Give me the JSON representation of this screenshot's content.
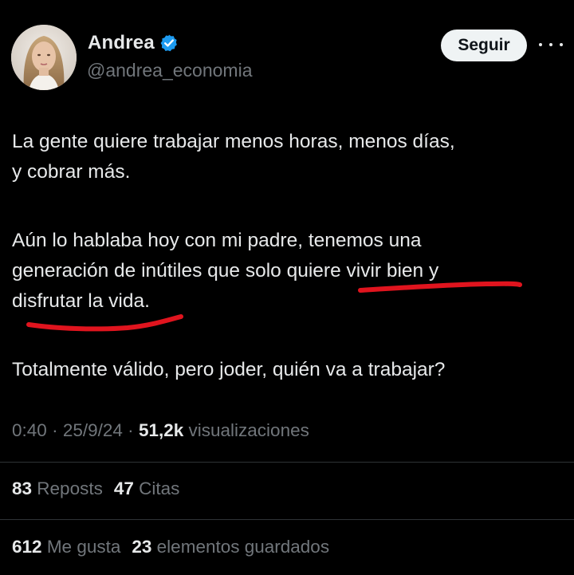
{
  "author": {
    "display_name": "Andrea",
    "handle": "@andrea_economia",
    "verified": true,
    "avatar_icon": "profile-photo"
  },
  "actions": {
    "follow_label": "Seguir",
    "more_icon": "more-horizontal-icon"
  },
  "tweet": {
    "paragraph1_line1": "La gente quiere trabajar menos horas, menos días,",
    "paragraph1_line2": "y cobrar más.",
    "paragraph2_line1": "Aún lo hablaba hoy con mi padre, tenemos una",
    "paragraph2_line2": "generación de inútiles que solo quiere vivir bien y",
    "paragraph2_line3": "disfrutar la vida.",
    "paragraph3_line1": "Totalmente válido, pero joder, quién va a trabajar?"
  },
  "meta": {
    "time": "0:40",
    "separator": "·",
    "date": "25/9/24",
    "views_count": "51,2k",
    "views_label": "visualizaciones"
  },
  "stats": {
    "reposts_count": "83",
    "reposts_label": "Reposts",
    "quotes_count": "47",
    "quotes_label": "Citas",
    "likes_count": "612",
    "likes_label": "Me gusta",
    "bookmarks_count": "23",
    "bookmarks_label": "elementos guardados"
  },
  "colors": {
    "background": "#000000",
    "text_primary": "#e7e9ea",
    "text_secondary": "#71767b",
    "verified_blue": "#1d9bf0",
    "annotation_red": "#e0141e",
    "button_bg": "#eff3f4"
  }
}
